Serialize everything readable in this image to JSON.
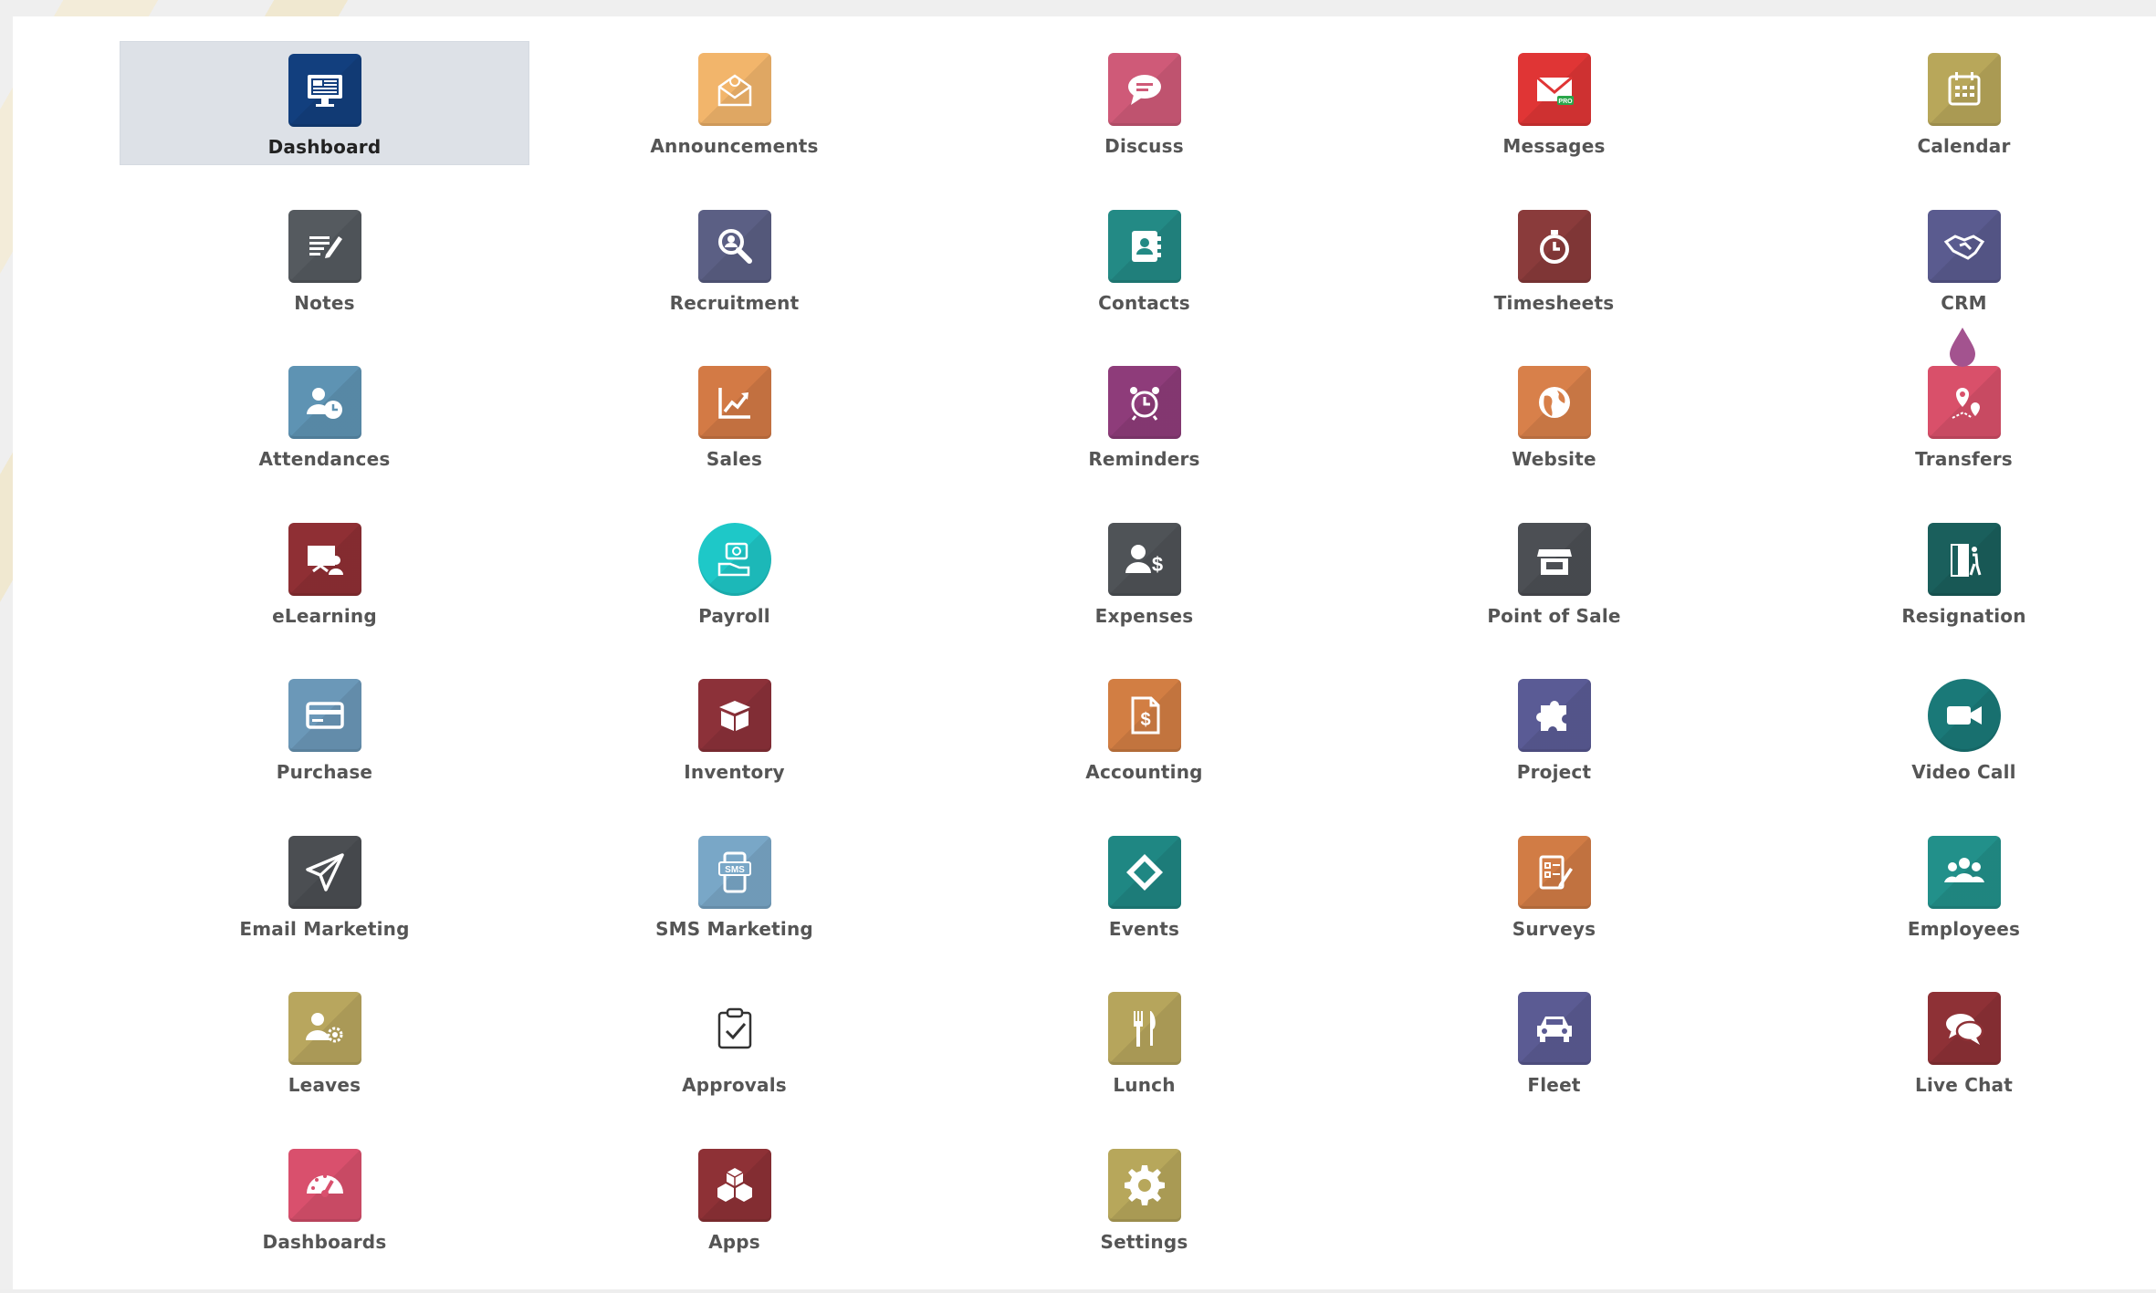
{
  "apps": [
    {
      "label": "Dashboard",
      "icon": "monitor-icon",
      "color": "#123f7e",
      "selected": true
    },
    {
      "label": "Announcements",
      "icon": "envelope-badge-icon",
      "color": "#f2b56b"
    },
    {
      "label": "Discuss",
      "icon": "chat-bubble-icon",
      "color": "#cf5a78"
    },
    {
      "label": "Messages",
      "icon": "mail-pro-icon",
      "color": "#e03535"
    },
    {
      "label": "Calendar",
      "icon": "calendar-icon",
      "color": "#b8a75a"
    },
    {
      "label": "Notes",
      "icon": "notepad-icon",
      "color": "#555a5f"
    },
    {
      "label": "Recruitment",
      "icon": "magnifier-person-icon",
      "color": "#5b5f84"
    },
    {
      "label": "Contacts",
      "icon": "address-book-icon",
      "color": "#238a85"
    },
    {
      "label": "Timesheets",
      "icon": "stopwatch-icon",
      "color": "#8a3b3b"
    },
    {
      "label": "CRM",
      "icon": "handshake-icon",
      "color": "#5a5b8f"
    },
    {
      "label": "Attendances",
      "icon": "person-clock-icon",
      "color": "#5e93b3"
    },
    {
      "label": "Sales",
      "icon": "trend-chart-icon",
      "color": "#d37a45"
    },
    {
      "label": "Reminders",
      "icon": "alarm-clock-icon",
      "color": "#8e3c7a"
    },
    {
      "label": "Website",
      "icon": "globe-icon",
      "color": "#d8804a"
    },
    {
      "label": "Transfers",
      "icon": "map-pin-icon",
      "color": "#d9506a"
    },
    {
      "label": "eLearning",
      "icon": "presentation-icon",
      "color": "#8f2f34"
    },
    {
      "label": "Payroll",
      "icon": "money-hand-icon",
      "color": "#1ec8c8"
    },
    {
      "label": "Expenses",
      "icon": "person-dollar-icon",
      "color": "#4f5357"
    },
    {
      "label": "Point of Sale",
      "icon": "shop-icon",
      "color": "#4c4f54"
    },
    {
      "label": "Resignation",
      "icon": "door-exit-icon",
      "color": "#1a5f5c"
    },
    {
      "label": "Purchase",
      "icon": "credit-card-icon",
      "color": "#6b98b8"
    },
    {
      "label": "Inventory",
      "icon": "box-icon",
      "color": "#8c3139"
    },
    {
      "label": "Accounting",
      "icon": "invoice-dollar-icon",
      "color": "#d27e43"
    },
    {
      "label": "Project",
      "icon": "puzzle-icon",
      "color": "#5a5b95"
    },
    {
      "label": "Video Call",
      "icon": "video-camera-icon",
      "color": "#1a7978"
    },
    {
      "label": "Email Marketing",
      "icon": "paper-plane-icon",
      "color": "#4b4e52"
    },
    {
      "label": "SMS Marketing",
      "icon": "phone-sms-icon",
      "color": "#79a7c7"
    },
    {
      "label": "Events",
      "icon": "ticket-icon",
      "color": "#1f8783"
    },
    {
      "label": "Surveys",
      "icon": "survey-clipboard-icon",
      "color": "#d17c45"
    },
    {
      "label": "Employees",
      "icon": "users-group-icon",
      "color": "#22908a"
    },
    {
      "label": "Leaves",
      "icon": "person-gear-icon",
      "color": "#b8a65e"
    },
    {
      "label": "Approvals",
      "icon": "clipboard-check-icon",
      "color": "#ffffff"
    },
    {
      "label": "Lunch",
      "icon": "fork-knife-icon",
      "color": "#b6a55c"
    },
    {
      "label": "Fleet",
      "icon": "car-icon",
      "color": "#5b5b93"
    },
    {
      "label": "Live Chat",
      "icon": "chat-bubbles-icon",
      "color": "#8e3136"
    },
    {
      "label": "Dashboards",
      "icon": "gauge-icon",
      "color": "#d9506d"
    },
    {
      "label": "Apps",
      "icon": "cubes-icon",
      "color": "#8e3136"
    },
    {
      "label": "Settings",
      "icon": "gear-icon",
      "color": "#b7a75b"
    }
  ],
  "decorations": {
    "drop_color": "#a3538f"
  }
}
